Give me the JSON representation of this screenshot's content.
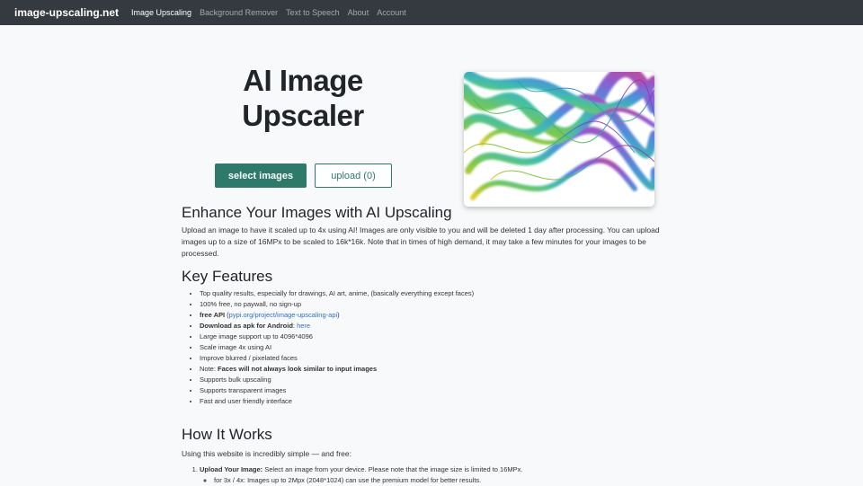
{
  "nav": {
    "brand": "image-upscaling.net",
    "items": [
      "Image Upscaling",
      "Background Remover",
      "Text to Speech",
      "About",
      "Account"
    ]
  },
  "hero": {
    "title_line1": "AI Image",
    "title_line2": "Upscaler",
    "select_button": "select images",
    "upload_button": "upload (0)"
  },
  "intro": {
    "heading": "Enhance Your Images with AI Upscaling",
    "body": "Upload an image to have it scaled up to 4x using AI! Images are only visible to you and will be deleted 1 day after processing. You can upload images up to a size of 16MPx to be scaled to 16k*16k. Note that in times of high demand, it may take a few minutes for your images to be processed."
  },
  "features": {
    "heading": "Key Features",
    "item1": "Top quality results, especially for drawings, AI art, anime, (basically everything except faces)",
    "item2": "100% free, no paywall, no sign-up",
    "api_label": "free API",
    "api_open": " (",
    "api_link": "pypi.org/project/image-upscaling-api",
    "api_close": ")",
    "apk_label": "Download as apk for Android",
    "apk_sep": ": ",
    "apk_link": "here",
    "item5": "Large image support up to 4096*4096",
    "item6": "Scale image 4x using AI",
    "item7": "Improve blurred / pixelated faces",
    "note_label": "Note: ",
    "note_bold": "Faces will not always look similar to input images",
    "item9": "Supports bulk upscaling",
    "item10": "Supports transparent images",
    "item11": "Fast and user friendly interface"
  },
  "how": {
    "heading": "How It Works",
    "intro": "Using this website is incredibly simple — and free:",
    "step1_label": "Upload Your Image:",
    "step1_text": " Select an image from your device. Please note that the image size is limited to 16MPx.",
    "step1_sub1": "for 3x / 4x: Images up to 2Mpx (2048*1024) can use the premium model for better results."
  },
  "colors": {
    "accent": "#2d7a6b",
    "navbar": "#343a40",
    "link": "#2a6fd6"
  }
}
